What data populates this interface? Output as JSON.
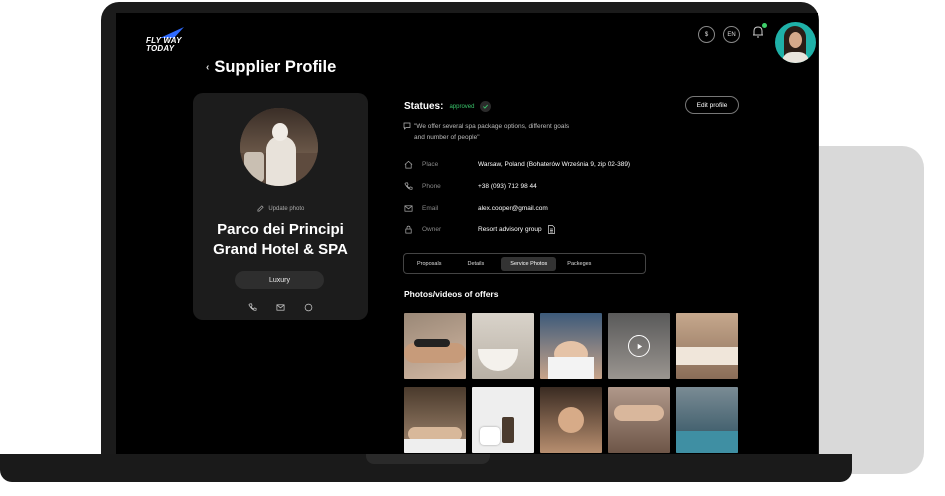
{
  "app": {
    "logo_text_line1": "FLY WAY",
    "logo_text_line2": "TODAY",
    "currency_label": "$",
    "language_label": "EN"
  },
  "page": {
    "title": "Supplier Profile"
  },
  "profile": {
    "update_photo": "Update photo",
    "name_line1": "Parco dei Principi",
    "name_line2": "Grand Hotel & SPA",
    "category": "Luxury"
  },
  "status": {
    "label": "Statues:",
    "value": "approved",
    "value_color": "#39c56b"
  },
  "edit_profile_label": "Edit profile",
  "quote": {
    "line1": "\"We offer several spa package options, different goals",
    "line2": "and number of people\""
  },
  "info": [
    {
      "icon": "home-icon",
      "label": "Place",
      "value": "Warsaw, Poland (Bohaterów Września 9, zip 02-389)"
    },
    {
      "icon": "phone-icon",
      "label": "Phone",
      "value": "+38 (093) 712 98 44"
    },
    {
      "icon": "mail-icon",
      "label": "Email",
      "value": "alex.cooper@gmail.com"
    },
    {
      "icon": "lock-icon",
      "label": "Owner",
      "value": "Resort advisory group"
    }
  ],
  "tabs": [
    {
      "label": "Proposals",
      "active": false
    },
    {
      "label": "Details",
      "active": false
    },
    {
      "label": "Service Photos",
      "active": true
    },
    {
      "label": "Packeges",
      "active": false
    }
  ],
  "gallery": {
    "title": "Photos/videos of offers"
  }
}
